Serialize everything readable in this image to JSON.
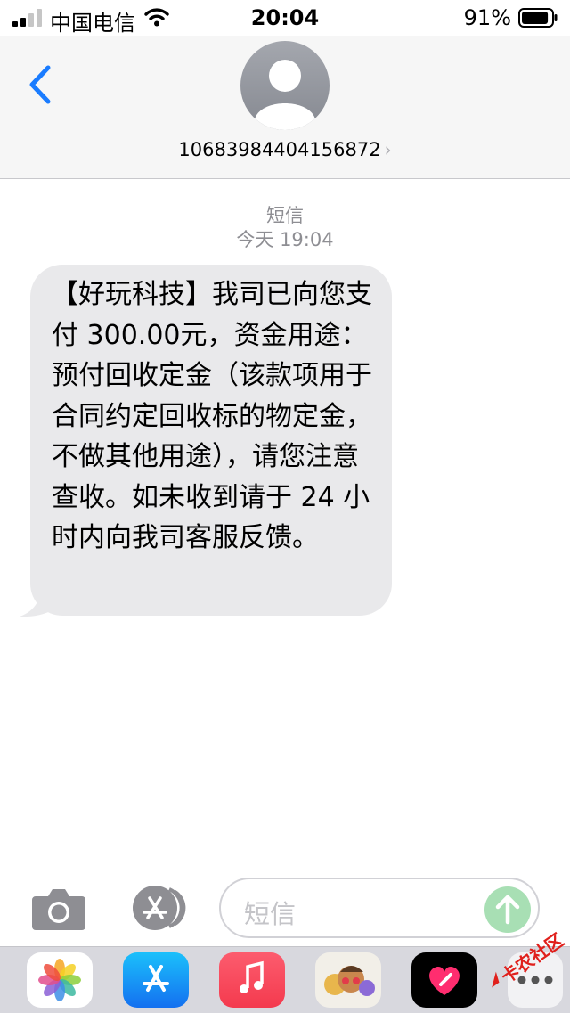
{
  "status_bar": {
    "carrier": "中国电信",
    "time": "20:04",
    "battery_percent": "91%",
    "battery_level": 0.91,
    "icons": [
      "signal-icon",
      "wifi-icon",
      "battery-icon"
    ]
  },
  "header": {
    "back_icon": "chevron-left-icon",
    "avatar_icon": "person-avatar-icon",
    "contact_number": "10683984404156872",
    "contact_chevron": "›"
  },
  "thread": {
    "service_label": "短信",
    "timestamp": "今天 19:04",
    "messages": [
      {
        "direction": "incoming",
        "text": "【好玩科技】我司已向您支付 300.00元，资金用途：预付回收定金（该款项用于合同约定回收标的物定金，不做其他用途），请您注意查收。如未收到请于 24 小时内向我司客服反馈。"
      }
    ]
  },
  "composer": {
    "camera_icon": "camera-icon",
    "apps_icon": "app-store-icon",
    "placeholder": "短信",
    "send_icon": "send-arrow-icon"
  },
  "app_drawer": {
    "apps": [
      "photos-icon",
      "app-store-icon",
      "music-icon",
      "memoji-icon",
      "digital-touch-icon",
      "more-icon"
    ]
  },
  "watermark": {
    "text": "卡农社区"
  },
  "colors": {
    "accent_blue": "#1a7cff",
    "bubble_gray": "#e9e9eb",
    "header_bg": "#f6f6f6",
    "send_green": "#a8dfb4",
    "drawer_bg": "#d8d8de"
  }
}
